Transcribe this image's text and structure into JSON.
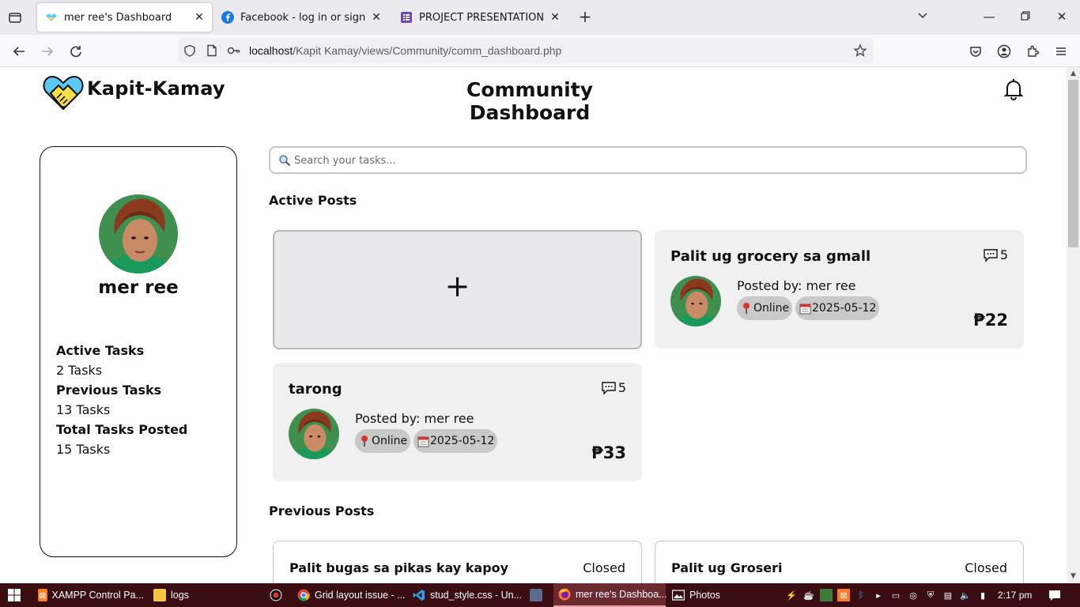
{
  "browser": {
    "tabs": [
      {
        "title": "mer ree's Dashboard",
        "active": true
      },
      {
        "title": "Facebook - log in or sign up",
        "active": false
      },
      {
        "title": "PROJECT PRESENTATION | REGI",
        "active": false
      }
    ],
    "url_host": "localhost",
    "url_path": "/Kapit Kamay/views/Community/comm_dashboard.php"
  },
  "header": {
    "brand": "Kapit-Kamay",
    "title": "Community Dashboard"
  },
  "profile": {
    "name": "mer ree",
    "stats": [
      {
        "label": "Active Tasks",
        "value": "2 Tasks"
      },
      {
        "label": "Previous Tasks",
        "value": "13 Tasks"
      },
      {
        "label": "Total Tasks Posted",
        "value": "15 Tasks"
      }
    ]
  },
  "search": {
    "placeholder": "Search your tasks..."
  },
  "sections": {
    "active": "Active Posts",
    "previous": "Previous Posts"
  },
  "add_post": {
    "label": "+"
  },
  "active_posts": [
    {
      "title": "Palit ug grocery sa gmall",
      "comments": "5",
      "posted_by": "Posted by: mer ree",
      "location": "Online",
      "date": "2025-05-12",
      "price": "₱22"
    },
    {
      "title": "tarong",
      "comments": "5",
      "posted_by": "Posted by: mer ree",
      "location": "Online",
      "date": "2025-05-12",
      "price": "₱33"
    }
  ],
  "previous_posts": [
    {
      "title": "Palit bugas sa pikas kay kapoy",
      "status": "Closed"
    },
    {
      "title": "Palit ug Groseri",
      "status": "Closed"
    }
  ],
  "taskbar": {
    "items": [
      {
        "label": "XAMPP Control Pa...",
        "icon": "xampp-icon"
      },
      {
        "label": "logs",
        "icon": "folder-icon"
      },
      {
        "label": "",
        "icon": "obs-icon"
      },
      {
        "label": "Grid layout issue - ...",
        "icon": "chrome-icon"
      },
      {
        "label": "stud_style.css - Un...",
        "icon": "vscode-icon"
      },
      {
        "label": "",
        "icon": "app-icon"
      },
      {
        "label": "mer ree's Dashboa...",
        "icon": "firefox-icon"
      },
      {
        "label": "Photos",
        "icon": "photos-icon"
      }
    ],
    "time": "2:17 pm"
  },
  "colors": {
    "card_bg": "#f0f0f0",
    "chip_bg": "#c9c9c9",
    "logo_blue": "#5bc8f5",
    "logo_yellow": "#f5e04a",
    "taskbar_bg": "#3a0d12"
  }
}
